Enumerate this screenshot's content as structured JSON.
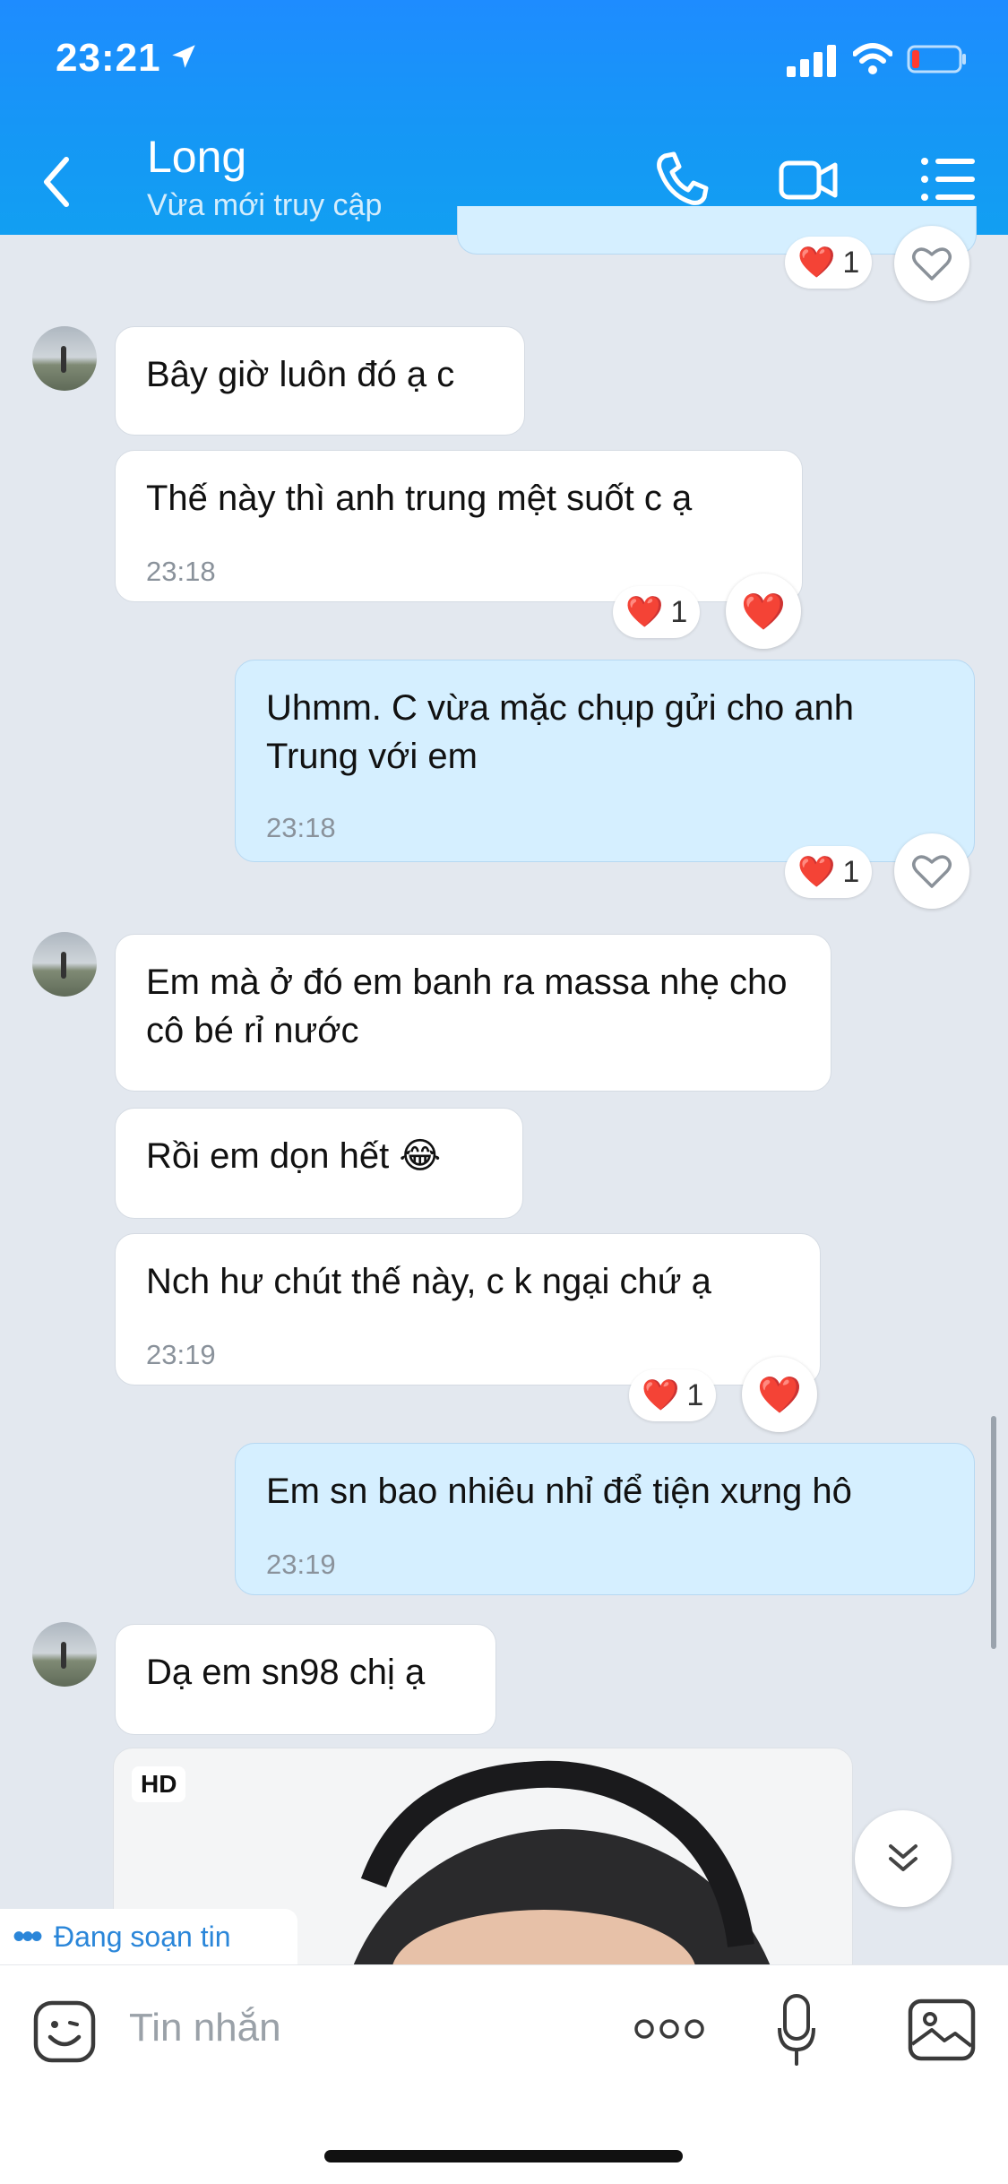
{
  "status_bar": {
    "time": "23:21"
  },
  "header": {
    "contact_name": "Long",
    "contact_status": "Vừa mới truy cập"
  },
  "messages": [
    {
      "sender": "them",
      "text": "Bây giờ luôn đó ạ c"
    },
    {
      "sender": "them",
      "text": "Thế này thì anh trung mệt suốt c ạ",
      "time": "23:18",
      "reaction_count": "1"
    },
    {
      "sender": "me",
      "text": "Uhmm. C vừa mặc chụp gửi cho anh Trung với em",
      "time": "23:18",
      "reaction_count": "1"
    },
    {
      "sender": "them",
      "text": "Em mà ở đó em banh ra massa nhẹ cho cô bé rỉ nước"
    },
    {
      "sender": "them",
      "text": "Rồi em dọn hết 😂"
    },
    {
      "sender": "them",
      "text": "Nch hư chút thế này, c k ngại chứ ạ",
      "time": "23:19",
      "reaction_count": "1"
    },
    {
      "sender": "me",
      "text": "Em sn bao nhiêu nhỉ để tiện xưng hô",
      "time": "23:19"
    },
    {
      "sender": "them",
      "text": "Dạ em sn98 chị ạ"
    }
  ],
  "top_partial_reaction_count": "1",
  "image_message": {
    "badge": "HD"
  },
  "typing_indicator": "Đang soạn tin",
  "composer": {
    "placeholder": "Tin nhắn"
  },
  "colors": {
    "header_blue": "#1e8cff",
    "my_bubble": "#d5efff",
    "reaction_heart": "#e8182b"
  }
}
